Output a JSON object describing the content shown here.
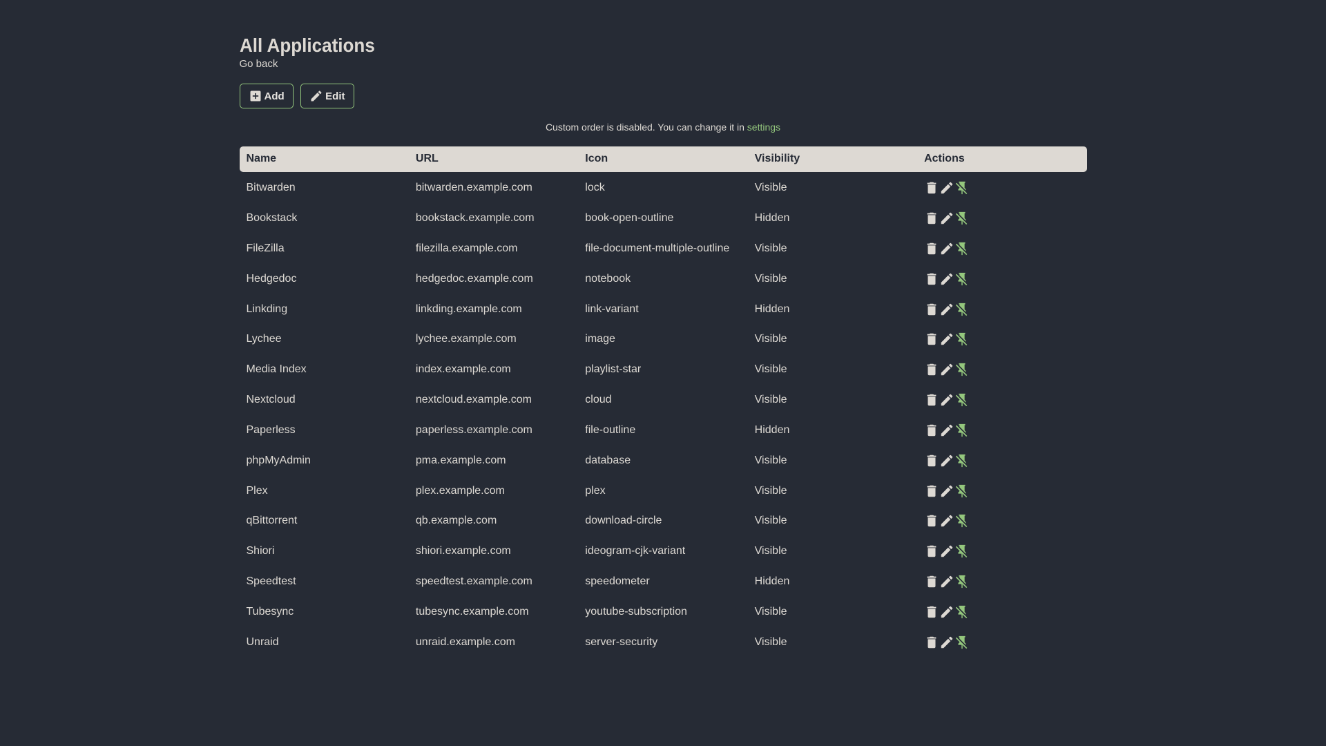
{
  "colors": {
    "background": "#262B35",
    "primary": "#DDD9D3",
    "accent": "#94C77D"
  },
  "page": {
    "title": "All Applications",
    "go_back_label": "Go back"
  },
  "toolbar": {
    "add_label": "Add",
    "edit_label": "Edit"
  },
  "message": {
    "text": "Custom order is disabled. You can change it in",
    "link_label": "settings"
  },
  "table": {
    "headers": [
      "Name",
      "URL",
      "Icon",
      "Visibility",
      "Actions"
    ],
    "rows": [
      {
        "name": "Bitwarden",
        "url": "bitwarden.example.com",
        "icon": "lock",
        "visibility": "Visible"
      },
      {
        "name": "Bookstack",
        "url": "bookstack.example.com",
        "icon": "book-open-outline",
        "visibility": "Hidden"
      },
      {
        "name": "FileZilla",
        "url": "filezilla.example.com",
        "icon": "file-document-multiple-outline",
        "visibility": "Visible"
      },
      {
        "name": "Hedgedoc",
        "url": "hedgedoc.example.com",
        "icon": "notebook",
        "visibility": "Visible"
      },
      {
        "name": "Linkding",
        "url": "linkding.example.com",
        "icon": "link-variant",
        "visibility": "Hidden"
      },
      {
        "name": "Lychee",
        "url": "lychee.example.com",
        "icon": "image",
        "visibility": "Visible"
      },
      {
        "name": "Media Index",
        "url": "index.example.com",
        "icon": "playlist-star",
        "visibility": "Visible"
      },
      {
        "name": "Nextcloud",
        "url": "nextcloud.example.com",
        "icon": "cloud",
        "visibility": "Visible"
      },
      {
        "name": "Paperless",
        "url": "paperless.example.com",
        "icon": "file-outline",
        "visibility": "Hidden"
      },
      {
        "name": "phpMyAdmin",
        "url": "pma.example.com",
        "icon": "database",
        "visibility": "Visible"
      },
      {
        "name": "Plex",
        "url": "plex.example.com",
        "icon": "plex",
        "visibility": "Visible"
      },
      {
        "name": "qBittorrent",
        "url": "qb.example.com",
        "icon": "download-circle",
        "visibility": "Visible"
      },
      {
        "name": "Shiori",
        "url": "shiori.example.com",
        "icon": "ideogram-cjk-variant",
        "visibility": "Visible"
      },
      {
        "name": "Speedtest",
        "url": "speedtest.example.com",
        "icon": "speedometer",
        "visibility": "Hidden"
      },
      {
        "name": "Tubesync",
        "url": "tubesync.example.com",
        "icon": "youtube-subscription",
        "visibility": "Visible"
      },
      {
        "name": "Unraid",
        "url": "unraid.example.com",
        "icon": "server-security",
        "visibility": "Visible"
      }
    ]
  }
}
